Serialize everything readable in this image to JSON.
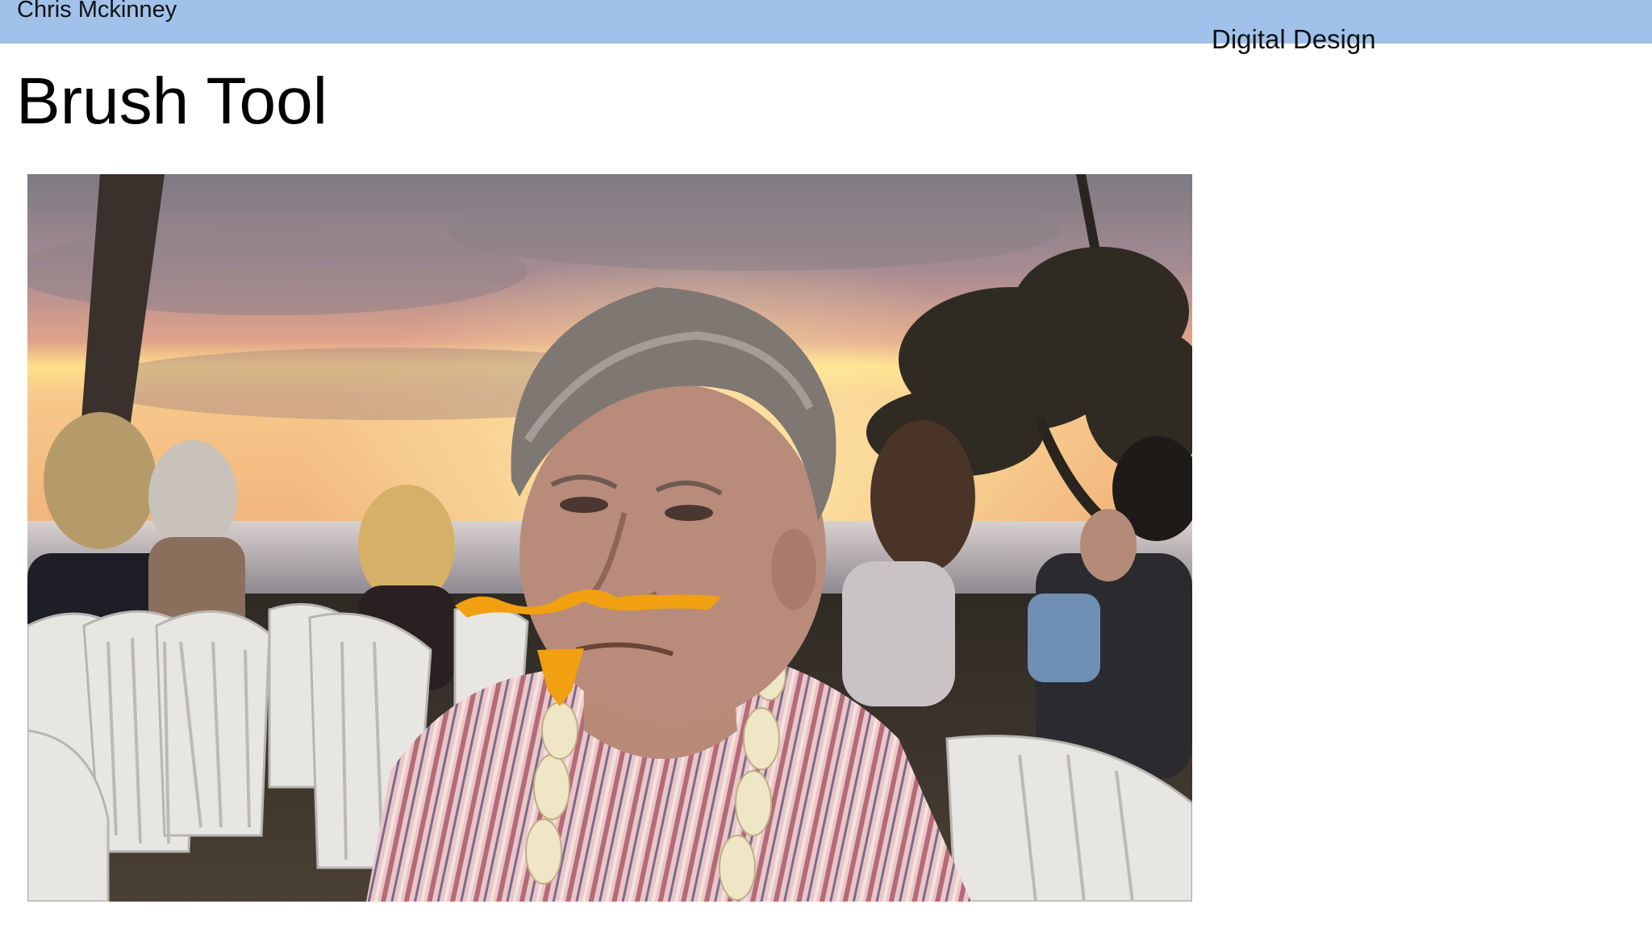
{
  "header": {
    "author": "Chris Mckinney",
    "course": "Digital Design"
  },
  "slide": {
    "title": "Brush Tool"
  },
  "photo": {
    "subject": "elderly person with orange brush-drawn mustache and goatee at a sunset gathering",
    "brush_color": "#f0a010"
  },
  "colors": {
    "header_bar": "#a0c2ea",
    "background": "#ffffff"
  }
}
